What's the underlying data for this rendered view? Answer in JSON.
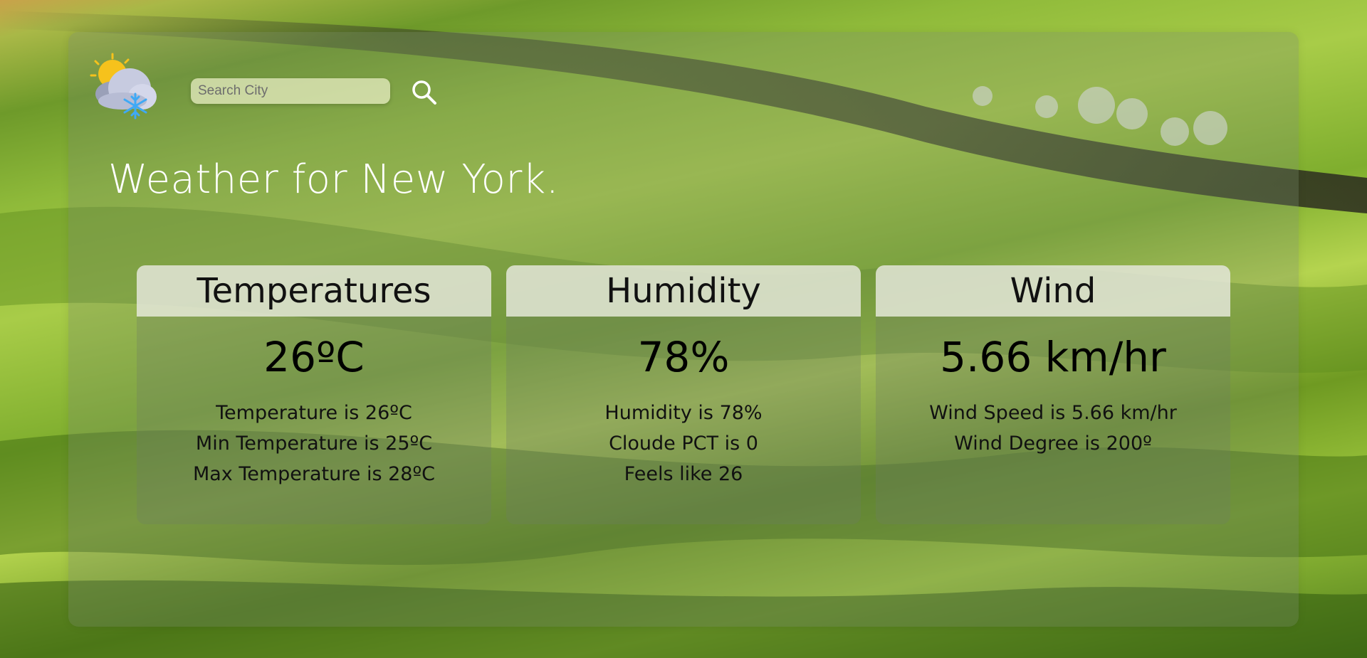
{
  "search": {
    "placeholder": "Search City",
    "value": ""
  },
  "title": "Weather for New York.",
  "icons": {
    "logo": "weather-sun-cloud-snow-icon",
    "search": "search-icon"
  },
  "cards": [
    {
      "header": "Temperatures",
      "value": "26ºC",
      "details": [
        "Temperature is 26ºC",
        "Min Temperature is 25ºC",
        "Max Temperature is 28ºC"
      ]
    },
    {
      "header": "Humidity",
      "value": "78%",
      "details": [
        "Humidity is 78%",
        "Cloude PCT is 0",
        "Feels like 26"
      ]
    },
    {
      "header": "Wind",
      "value": "5.66 km/hr",
      "details": [
        "Wind Speed is 5.66 km/hr",
        "Wind Degree is 200º"
      ]
    }
  ],
  "colors": {
    "title_text": "#ffffff",
    "card_header_bg": "#eef0e4",
    "landscape_green": "#8fba3a"
  }
}
